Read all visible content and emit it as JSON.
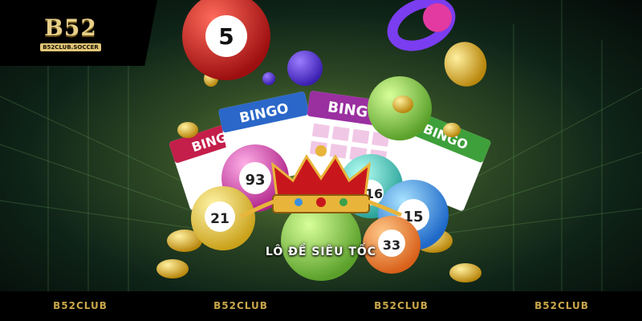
{
  "logo": {
    "main_text": "B52",
    "sub_text": "B52CLUB.SOCCER"
  },
  "art": {
    "ball_numbers": [
      "5",
      "93",
      "21",
      "15",
      "33",
      "16"
    ],
    "card_labels": [
      "BINGO",
      "BINGO",
      "BINGO",
      "BINGO"
    ]
  },
  "caption": "LÔ ĐỀ SIÊU TỐC",
  "footer": {
    "items": [
      "B52CLUB",
      "B52CLUB",
      "B52CLUB",
      "B52CLUB"
    ]
  },
  "colors": {
    "gold": "#c9a64a",
    "green_glow": "#6d8f3a",
    "background": "#000000"
  }
}
